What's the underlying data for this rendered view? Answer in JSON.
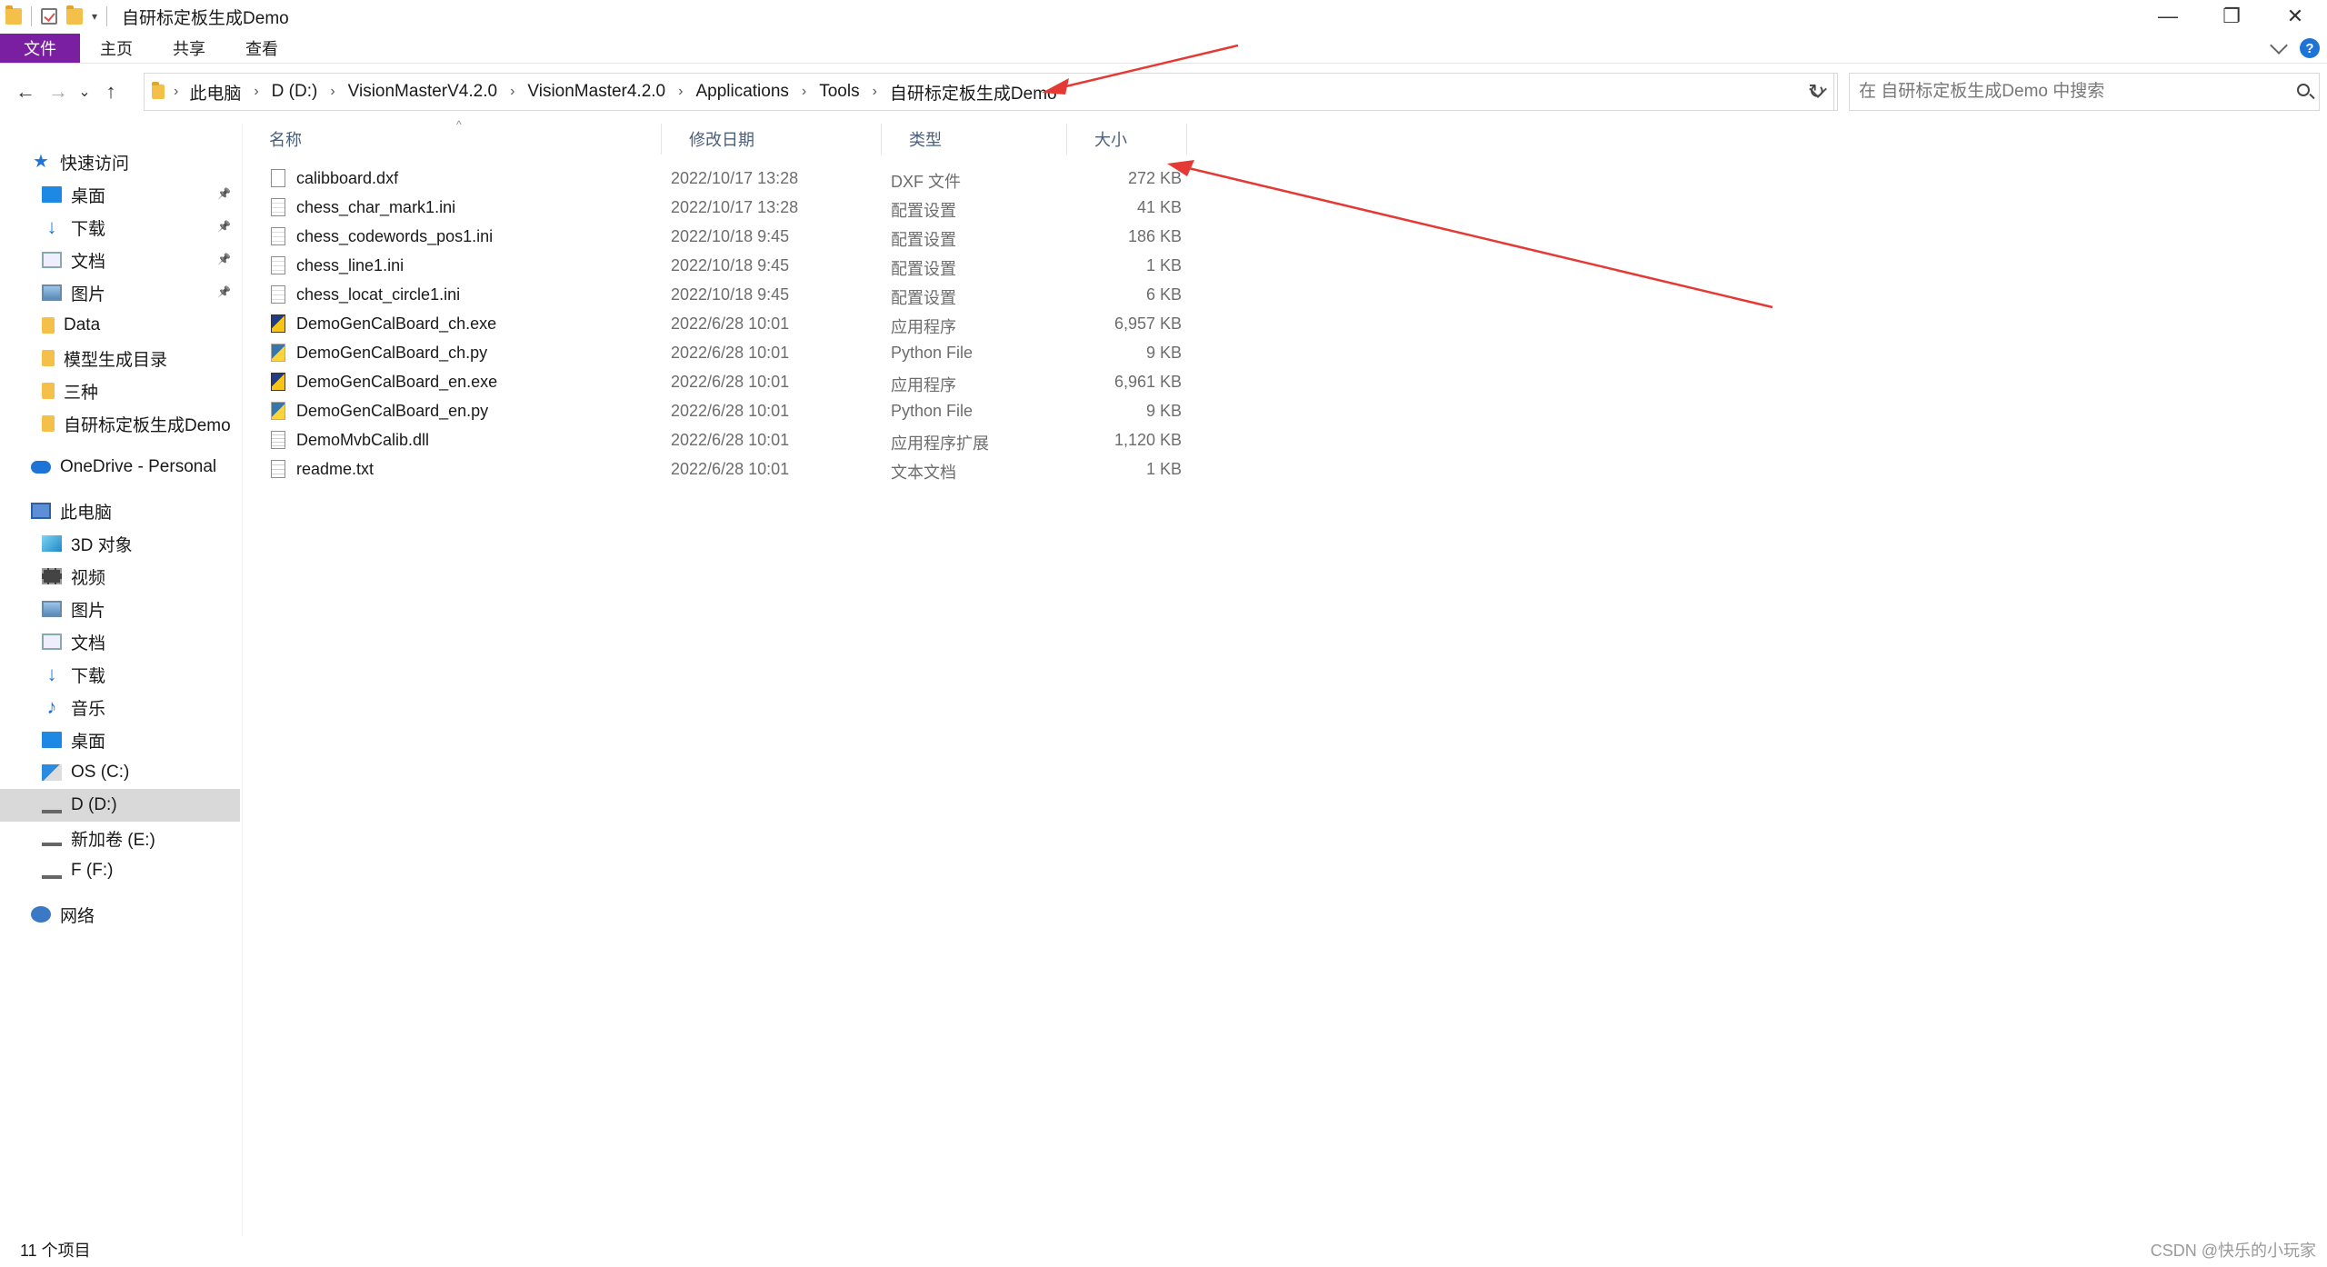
{
  "window": {
    "title": "自研标定板生成Demo",
    "minimize": "—",
    "maximize": "❐",
    "close": "✕"
  },
  "ribbon": {
    "tabs": [
      "文件",
      "主页",
      "共享",
      "查看"
    ],
    "help": "?"
  },
  "nav": {
    "back": "←",
    "forward": "→",
    "recent": "⌄",
    "up": "↑",
    "refresh": "↻",
    "breadcrumbs": [
      "此电脑",
      "D (D:)",
      "VisionMasterV4.2.0",
      "VisionMaster4.2.0",
      "Applications",
      "Tools",
      "自研标定板生成Demo"
    ],
    "search_placeholder": "在 自研标定板生成Demo 中搜索"
  },
  "sidebar": {
    "items": [
      {
        "label": "快速访问",
        "icon": "star-icon",
        "pinned": false
      },
      {
        "label": "桌面",
        "icon": "desktop-icon",
        "pinned": true
      },
      {
        "label": "下载",
        "icon": "download-icon",
        "pinned": true
      },
      {
        "label": "文档",
        "icon": "document-icon",
        "pinned": true
      },
      {
        "label": "图片",
        "icon": "picture-icon",
        "pinned": true
      },
      {
        "label": "Data",
        "icon": "folder-icon",
        "pinned": false
      },
      {
        "label": "模型生成目录",
        "icon": "folder-icon",
        "pinned": false
      },
      {
        "label": "三种",
        "icon": "folder-icon",
        "pinned": false
      },
      {
        "label": "自研标定板生成Demo",
        "icon": "folder-icon",
        "pinned": false
      },
      {
        "label": "OneDrive - Personal",
        "icon": "cloud-icon",
        "pinned": false
      },
      {
        "label": "此电脑",
        "icon": "pc-icon",
        "pinned": false
      },
      {
        "label": "3D 对象",
        "icon": "3d-objects-icon",
        "pinned": false
      },
      {
        "label": "视频",
        "icon": "video-icon",
        "pinned": false
      },
      {
        "label": "图片",
        "icon": "picture-icon",
        "pinned": false
      },
      {
        "label": "文档",
        "icon": "document-icon",
        "pinned": false
      },
      {
        "label": "下载",
        "icon": "download-icon",
        "pinned": false
      },
      {
        "label": "音乐",
        "icon": "music-icon",
        "pinned": false
      },
      {
        "label": "桌面",
        "icon": "desktop-icon",
        "pinned": false
      },
      {
        "label": "OS (C:)",
        "icon": "os-drive-icon",
        "pinned": false
      },
      {
        "label": "D (D:)",
        "icon": "drive-icon",
        "pinned": false,
        "selected": true
      },
      {
        "label": "新加卷 (E:)",
        "icon": "drive-icon",
        "pinned": false
      },
      {
        "label": "F (F:)",
        "icon": "drive-icon",
        "pinned": false
      },
      {
        "label": "网络",
        "icon": "network-icon",
        "pinned": false
      }
    ]
  },
  "columns": {
    "name": "名称",
    "date": "修改日期",
    "type": "类型",
    "size": "大小"
  },
  "files": [
    {
      "name": "calibboard.dxf",
      "date": "2022/10/17 13:28",
      "type": "DXF 文件",
      "size": "272 KB",
      "icon": "dxf-file-icon"
    },
    {
      "name": "chess_char_mark1.ini",
      "date": "2022/10/17 13:28",
      "type": "配置设置",
      "size": "41 KB",
      "icon": "ini-file-icon"
    },
    {
      "name": "chess_codewords_pos1.ini",
      "date": "2022/10/18 9:45",
      "type": "配置设置",
      "size": "186 KB",
      "icon": "ini-file-icon"
    },
    {
      "name": "chess_line1.ini",
      "date": "2022/10/18 9:45",
      "type": "配置设置",
      "size": "1 KB",
      "icon": "ini-file-icon"
    },
    {
      "name": "chess_locat_circle1.ini",
      "date": "2022/10/18 9:45",
      "type": "配置设置",
      "size": "6 KB",
      "icon": "ini-file-icon"
    },
    {
      "name": "DemoGenCalBoard_ch.exe",
      "date": "2022/6/28 10:01",
      "type": "应用程序",
      "size": "6,957 KB",
      "icon": "exe-file-icon"
    },
    {
      "name": "DemoGenCalBoard_ch.py",
      "date": "2022/6/28 10:01",
      "type": "Python File",
      "size": "9 KB",
      "icon": "python-file-icon"
    },
    {
      "name": "DemoGenCalBoard_en.exe",
      "date": "2022/6/28 10:01",
      "type": "应用程序",
      "size": "6,961 KB",
      "icon": "exe-file-icon"
    },
    {
      "name": "DemoGenCalBoard_en.py",
      "date": "2022/6/28 10:01",
      "type": "Python File",
      "size": "9 KB",
      "icon": "python-file-icon"
    },
    {
      "name": "DemoMvbCalib.dll",
      "date": "2022/6/28 10:01",
      "type": "应用程序扩展",
      "size": "1,120 KB",
      "icon": "dll-file-icon"
    },
    {
      "name": "readme.txt",
      "date": "2022/6/28 10:01",
      "type": "文本文档",
      "size": "1 KB",
      "icon": "txt-file-icon"
    }
  ],
  "status": {
    "item_count": "11 个项目",
    "watermark": "CSDN @快乐的小玩家"
  },
  "colors": {
    "file_tab": "#7b1fa2",
    "selected": "#d9d9d9",
    "arrow": "#e53935",
    "header_text": "#4c607a"
  }
}
